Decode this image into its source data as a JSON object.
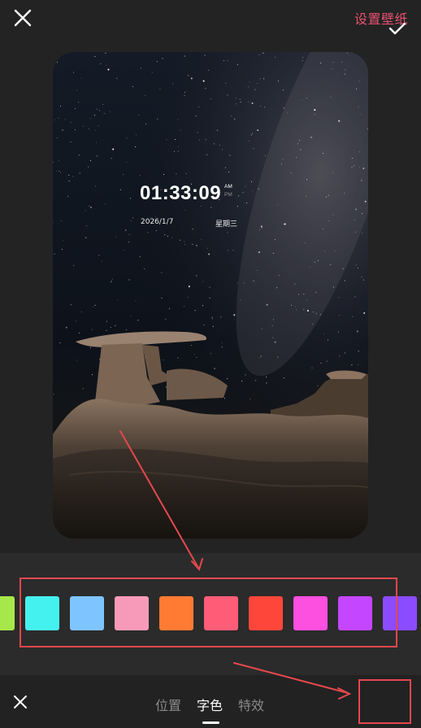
{
  "header": {
    "close_icon": "close-icon",
    "set_wallpaper_label": "设置壁纸",
    "accent_color": "#e8526f"
  },
  "preview": {
    "time": "01:33:09",
    "am": "AM",
    "pm": "PM",
    "date": "2026/1/7",
    "weekday": "星期三"
  },
  "palette": {
    "swatches": [
      {
        "name": "lime",
        "color": "#a6e84a"
      },
      {
        "name": "cyan",
        "color": "#45f1ef"
      },
      {
        "name": "light-blue",
        "color": "#7ec4ff"
      },
      {
        "name": "pink",
        "color": "#f79ab9"
      },
      {
        "name": "orange",
        "color": "#ff7b34"
      },
      {
        "name": "rose",
        "color": "#ff5c78"
      },
      {
        "name": "red",
        "color": "#ff463a"
      },
      {
        "name": "magenta",
        "color": "#fd4fe0"
      },
      {
        "name": "purple",
        "color": "#c446ff"
      },
      {
        "name": "violet",
        "color": "#8b4bff"
      }
    ]
  },
  "bottom": {
    "tabs": [
      {
        "label": "位置",
        "active": false
      },
      {
        "label": "字色",
        "active": true
      },
      {
        "label": "特效",
        "active": false
      }
    ],
    "close_icon": "close-icon",
    "confirm_icon": "check-icon"
  },
  "annotation_color": "#e5484d"
}
